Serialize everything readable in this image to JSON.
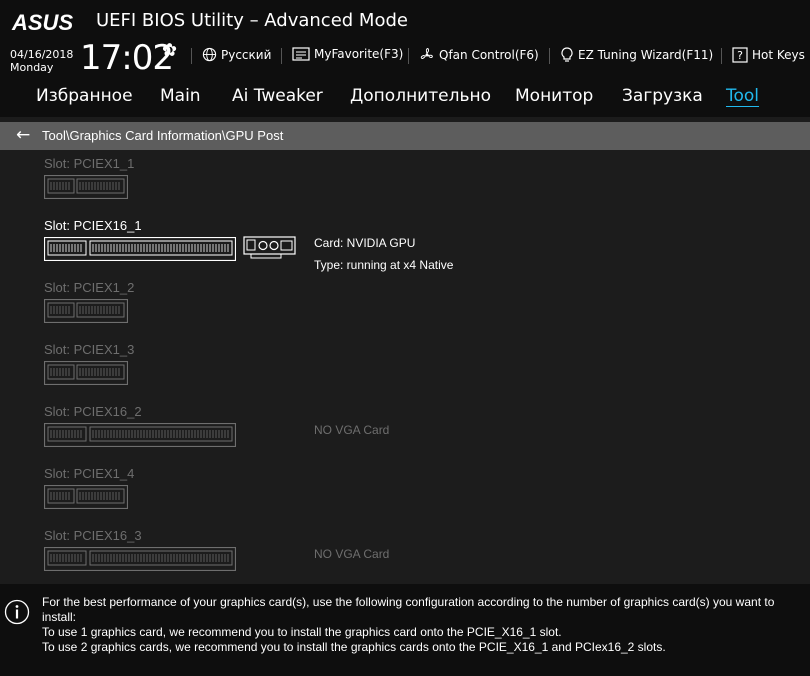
{
  "header": {
    "logo": "ASUS",
    "title": "UEFI BIOS Utility – Advanced Mode",
    "date": "04/16/2018",
    "weekday": "Monday",
    "time": "17:02",
    "language": "Русский",
    "myfavorite": "MyFavorite(F3)",
    "qfan": "Qfan Control(F6)",
    "ez_tuning": "EZ Tuning Wizard(F11)",
    "hotkeys": "Hot Keys",
    "icons": [
      "gear-icon",
      "globe-icon",
      "myfavorite-icon",
      "fan-icon",
      "lightbulb-icon",
      "question-icon"
    ]
  },
  "nav": {
    "tabs": [
      {
        "label": "Избранное",
        "active": false
      },
      {
        "label": "Main",
        "active": false
      },
      {
        "label": "Ai Tweaker",
        "active": false
      },
      {
        "label": "Дополнительно",
        "active": false
      },
      {
        "label": "Монитор",
        "active": false
      },
      {
        "label": "Загрузка",
        "active": false
      },
      {
        "label": "Tool",
        "active": true
      }
    ]
  },
  "breadcrumb": "Tool\\Graphics Card Information\\GPU Post",
  "slots": [
    {
      "label": "Slot: PCIEX1_1",
      "type": "x1",
      "active": false
    },
    {
      "label": "Slot: PCIEX16_1",
      "type": "x16",
      "active": true,
      "card": "Card: NVIDIA GPU",
      "card_type": "Type: running at x4 Native"
    },
    {
      "label": "Slot: PCIEX1_2",
      "type": "x1",
      "active": false
    },
    {
      "label": "Slot: PCIEX1_3",
      "type": "x1",
      "active": false
    },
    {
      "label": "Slot: PCIEX16_2",
      "type": "x16",
      "active": false,
      "status": "NO VGA Card"
    },
    {
      "label": "Slot: PCIEX1_4",
      "type": "x1",
      "active": false
    },
    {
      "label": "Slot: PCIEX16_3",
      "type": "x16",
      "active": false,
      "status": "NO VGA Card"
    }
  ],
  "footer": {
    "lines": [
      "For the best performance of your graphics card(s), use the following configuration according to the number of graphics card(s) you want to install:",
      "To use 1 graphics card, we recommend you to install  the graphics card onto the PCIE_X16_1 slot.",
      "To use 2 graphics cards, we recommend you to install the graphics cards onto the PCIE_X16_1 and PCIex16_2 slots."
    ]
  },
  "colors": {
    "accent": "#21b9ee",
    "background": "#1c1c1c",
    "header": "#0e0e0e",
    "breadcrumb": "#5d5d5d",
    "inactive_text": "#6e6e6e"
  }
}
